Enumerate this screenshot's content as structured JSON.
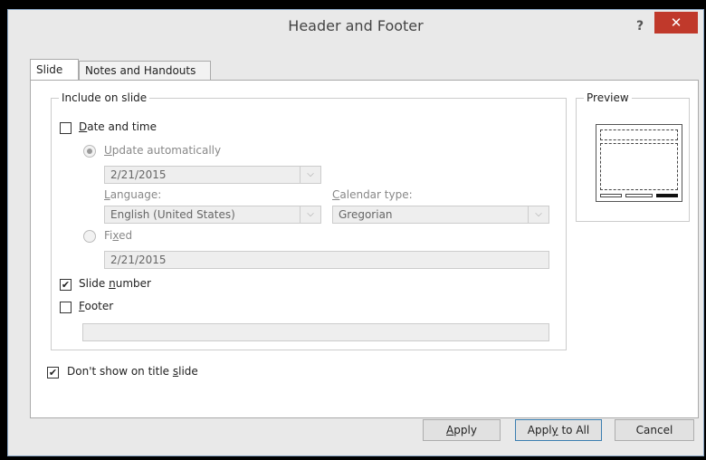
{
  "window": {
    "title": "Header and Footer",
    "help_label": "?",
    "close_label": "✕"
  },
  "tabs": [
    {
      "label": "Slide",
      "active": true
    },
    {
      "label": "Notes and Handouts",
      "active": false
    }
  ],
  "include": {
    "legend": "Include on slide",
    "date_time": {
      "pre": "",
      "key": "D",
      "post": "ate and time",
      "checked": false
    },
    "update_auto": {
      "pre": "",
      "key": "U",
      "post": "pdate automatically",
      "selected": true
    },
    "date_value": "2/21/2015",
    "language_label": {
      "pre": "",
      "key": "L",
      "post": "anguage:"
    },
    "language_value": "English (United States)",
    "calendar_label": {
      "pre": "",
      "key": "C",
      "post": "alendar type:"
    },
    "calendar_value": "Gregorian",
    "fixed": {
      "pre": "Fi",
      "key": "x",
      "post": "ed",
      "selected": false
    },
    "fixed_value": "2/21/2015",
    "slide_number": {
      "pre": "Slide ",
      "key": "n",
      "post": "umber",
      "checked": true
    },
    "footer": {
      "pre": "",
      "key": "F",
      "post": "ooter",
      "checked": false
    },
    "footer_value": ""
  },
  "dont_show": {
    "pre": "Don't show on title ",
    "key": "s",
    "post": "lide",
    "checked": true
  },
  "preview": {
    "legend": "Preview"
  },
  "buttons": {
    "apply": {
      "pre": "",
      "key": "A",
      "post": "pply"
    },
    "apply_all": {
      "pre": "Appl",
      "key": "y",
      "post": " to All"
    },
    "cancel": {
      "label": "Cancel"
    }
  },
  "icons": {
    "check": "✔",
    "arrow": "⌵"
  }
}
